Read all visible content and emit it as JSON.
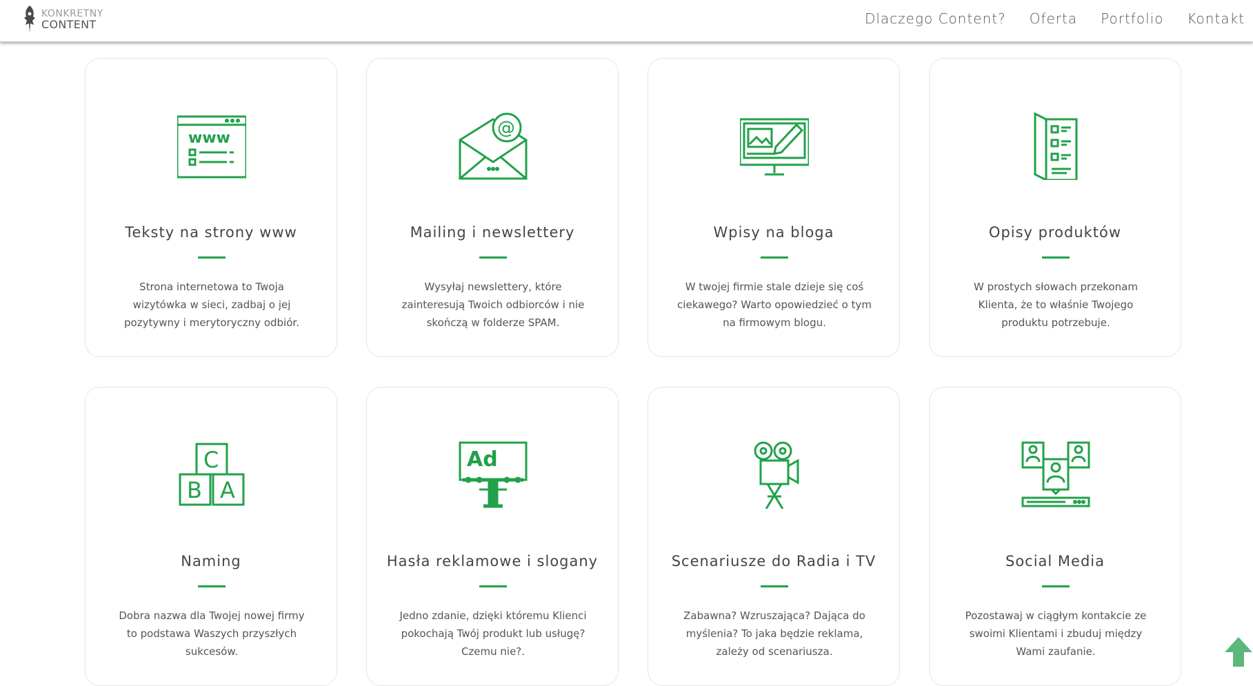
{
  "brand": {
    "line1": "KONKRETNY",
    "line2": "CONTENT"
  },
  "nav": [
    "Dlaczego Content?",
    "Oferta",
    "Portfolio",
    "Kontakt"
  ],
  "colors": {
    "accent": "#21a14a",
    "text": "#444444",
    "border": "#e6e6e6"
  },
  "cards": [
    {
      "icon": "website-icon",
      "title": "Teksty na strony www",
      "text": "Strona internetowa to Twoja wizytówka w sieci, zadbaj o jej pozytywny i merytoryczny odbiór."
    },
    {
      "icon": "email-icon",
      "title": "Mailing i newslettery",
      "text": "Wysyłaj newslettery, które zainteresują Twoich odbiorców i nie skończą w folderze SPAM."
    },
    {
      "icon": "blog-icon",
      "title": "Wpisy na bloga",
      "text": "W twojej firmie stale dzieje się coś ciekawego? Warto opowiedzieć o tym na firmowym blogu."
    },
    {
      "icon": "product-list-icon",
      "title": "Opisy produktów",
      "text": "W prostych słowach przekonam Klienta, że to właśnie Twojego produktu potrzebuje."
    },
    {
      "icon": "blocks-icon",
      "title": "Naming",
      "text": "Dobra nazwa dla Twojej nowej firmy to podstawa Waszych przyszłych sukcesów."
    },
    {
      "icon": "billboard-icon",
      "title": "Hasła reklamowe i slogany",
      "text": "Jedno zdanie, dzięki któremu Klienci pokochają Twój produkt lub usługę? Czemu nie?."
    },
    {
      "icon": "film-camera-icon",
      "title": "Scenariusze do Radia i TV",
      "text": "Zabawna? Wzruszająca? Dająca do myślenia? To jaka będzie reklama, zależy od scenariusza."
    },
    {
      "icon": "social-media-icon",
      "title": "Social Media",
      "text": "Pozostawaj w ciągłym kontakcie ze swoimi Klientami i zbuduj między Wami zaufanie."
    }
  ],
  "scroll_top": {
    "icon": "arrow-up-icon"
  }
}
